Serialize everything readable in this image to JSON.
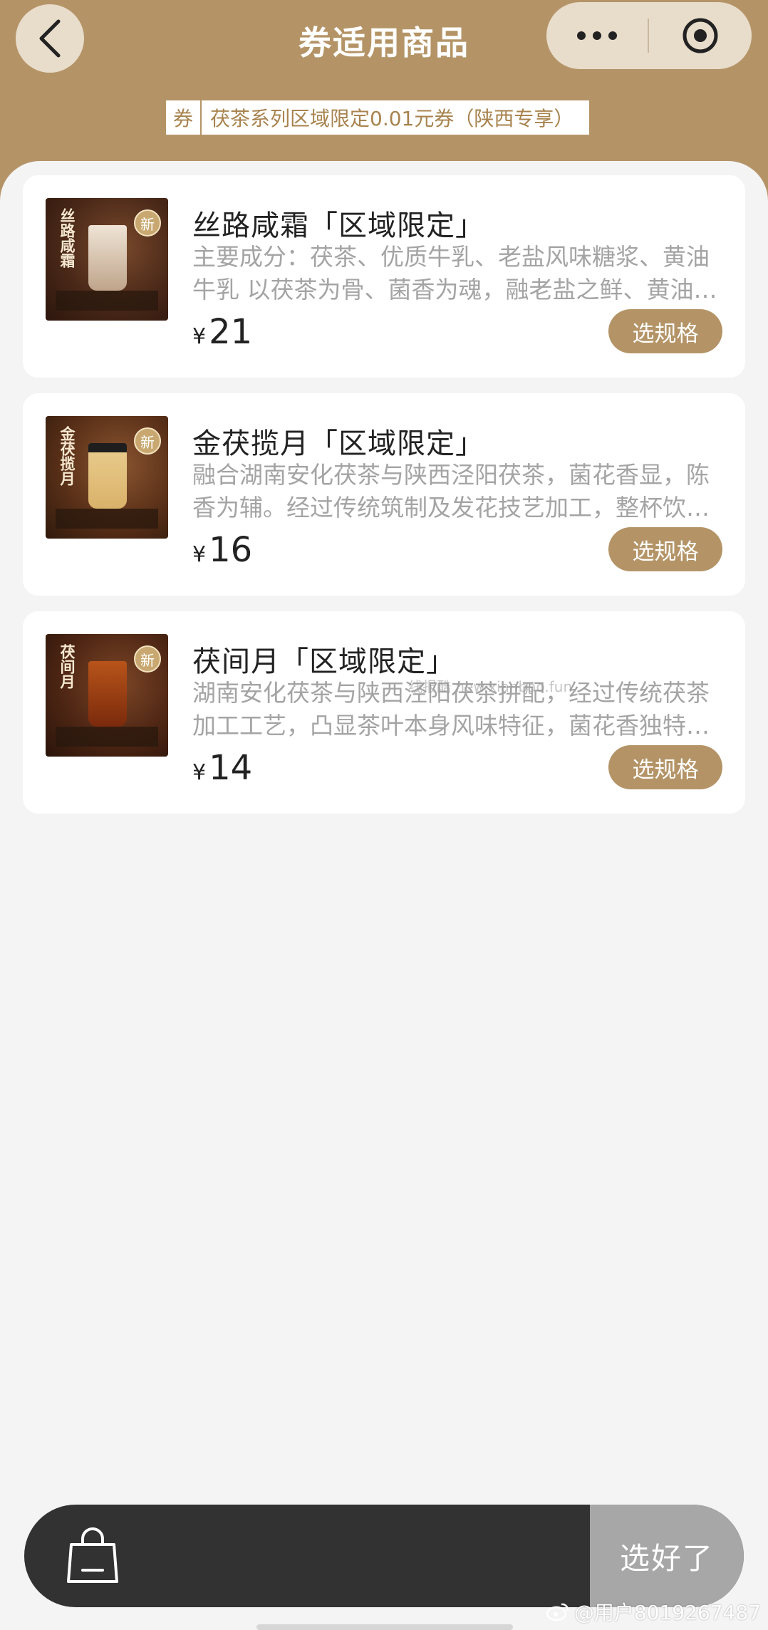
{
  "header": {
    "title": "券适用商品",
    "coupon_tag_prefix": "券",
    "coupon_tag_text": "茯茶系列区域限定0.01元券（陕西专享）",
    "accent_color": "#b49467"
  },
  "products": [
    {
      "name": "丝路咸霜「区域限定」",
      "description": "主要成分：茯茶、优质牛乳、老盐风味糖浆、黄油牛乳 以茯茶为骨、菌香为魂，融老盐之鲜、黄油牛乳之醇厚",
      "currency": "¥",
      "price": "21",
      "button_label": "选规格",
      "thumb_title": "丝路咸霜",
      "thumb_badge": "新"
    },
    {
      "name": "金茯揽月「区域限定」",
      "description": "融合湖南安化茯茶与陕西泾阳茯茶，菌花香显，陈香为辅。经过传统筑制及发花技艺加工，整杯饮品醇厚顺滑",
      "currency": "¥",
      "price": "16",
      "button_label": "选规格",
      "thumb_title": "金茯揽月",
      "thumb_badge": "新"
    },
    {
      "name": "茯间月「区域限定」",
      "description": "湖南安化茯茶与陕西泾阳茯茶拼配，经过传统茯茶加工工艺，凸显茶叶本身风味特征，菌花香独特悠长",
      "currency": "¥",
      "price": "14",
      "button_label": "选规格",
      "thumb_title": "茯间月",
      "thumb_badge": "新"
    }
  ],
  "cart": {
    "confirm_label": "选好了"
  },
  "watermarks": {
    "middle": "线报酷 new.xianbao.fun",
    "bottom": "@用户8019267487"
  }
}
